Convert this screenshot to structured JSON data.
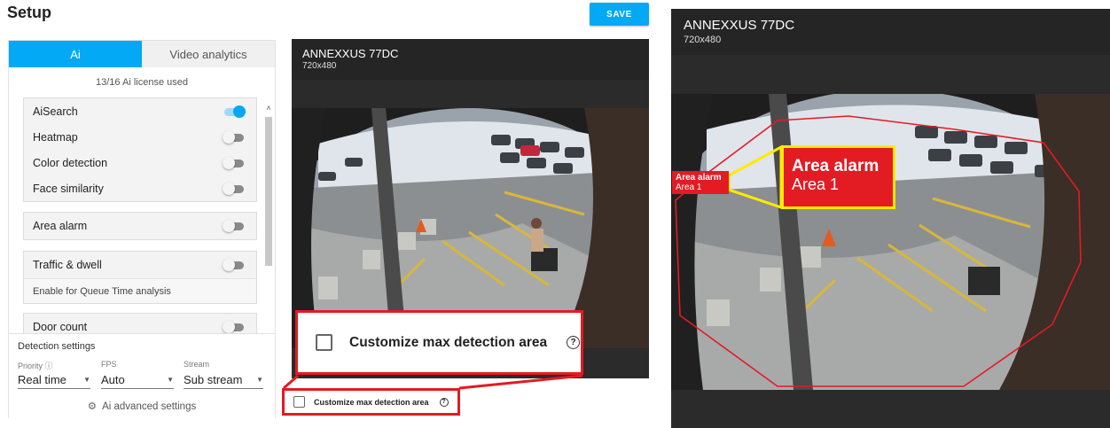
{
  "header": {
    "title": "Setup",
    "save_label": "SAVE"
  },
  "tabs": [
    {
      "label": "Ai",
      "active": true
    },
    {
      "label": "Video analytics",
      "active": false
    }
  ],
  "license_text": "13/16 Ai license used",
  "features": [
    {
      "label": "AiSearch",
      "enabled": true
    },
    {
      "label": "Heatmap",
      "enabled": false
    },
    {
      "label": "Color detection",
      "enabled": false
    },
    {
      "label": "Face similarity",
      "enabled": false
    },
    {
      "label": "Area alarm",
      "enabled": false
    },
    {
      "label": "Traffic & dwell",
      "enabled": false,
      "note": "Enable for Queue Time analysis"
    },
    {
      "label": "Door count",
      "enabled": false
    }
  ],
  "detection_settings": {
    "title": "Detection settings",
    "priority": {
      "label": "Priority",
      "value": "Real time"
    },
    "fps": {
      "label": "FPS",
      "value": "Auto"
    },
    "stream": {
      "label": "Stream",
      "value": "Sub stream"
    },
    "advanced_label": "Ai advanced settings"
  },
  "camera": {
    "name": "ANNEXXUS 77DC",
    "resolution": "720x480"
  },
  "customize": {
    "label": "Customize max detection area",
    "help_glyph": "?"
  },
  "alarm": {
    "title": "Area alarm",
    "area": "Area 1"
  },
  "icons": {
    "help": "help-circle-icon",
    "gear": "gear-icon",
    "caret": "caret-down-icon"
  },
  "colors": {
    "accent": "#03a9f4",
    "alarm_red": "#e31b23",
    "highlight_yellow": "#ffea00",
    "panel_dark": "#2b2b2b"
  }
}
